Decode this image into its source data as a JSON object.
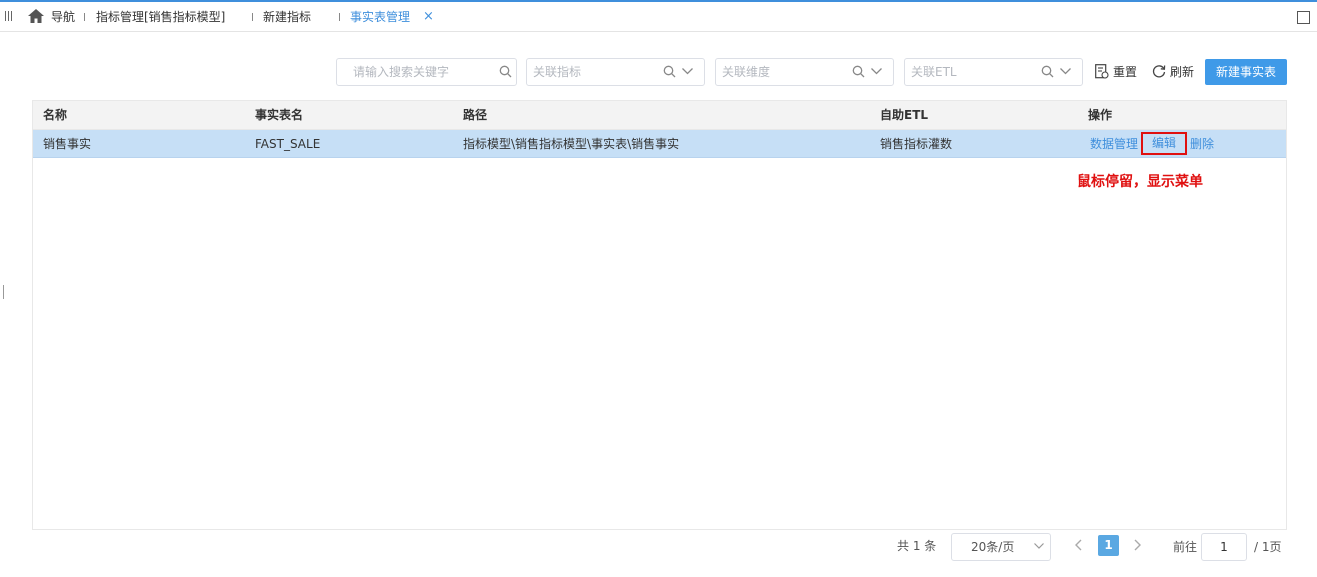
{
  "tabs": {
    "items": [
      {
        "label": "导航"
      },
      {
        "label": "指标管理[销售指标模型]"
      },
      {
        "label": "新建指标"
      },
      {
        "label": "事实表管理"
      }
    ],
    "close_glyph": "×"
  },
  "toolbar": {
    "search_placeholder": "请输入搜索关键字",
    "metric_placeholder": "关联指标",
    "dimension_placeholder": "关联维度",
    "etl_placeholder": "关联ETL",
    "reset_label": "重置",
    "refresh_label": "刷新",
    "new_label": "新建事实表"
  },
  "table": {
    "headers": {
      "name": "名称",
      "table_name": "事实表名",
      "path": "路径",
      "etl": "自助ETL",
      "ops": "操作"
    },
    "rows": [
      {
        "name": "销售事实",
        "table_name": "FAST_SALE",
        "path": "指标模型\\销售指标模型\\事实表\\销售事实",
        "etl": "销售指标灌数",
        "ops": {
          "data": "数据管理",
          "edit": "编辑",
          "delete": "删除"
        }
      }
    ]
  },
  "annotation": "鼠标停留，显示菜单",
  "pagination": {
    "total": "共 1 条",
    "page_size": "20条/页",
    "current_page": "1",
    "goto_label": "前往",
    "goto_value": "1",
    "pages_label": "/ 1页"
  },
  "colors": {
    "accent": "#3f8fdc",
    "highlight": "#e01010",
    "selected_row": "#c6dff6"
  }
}
